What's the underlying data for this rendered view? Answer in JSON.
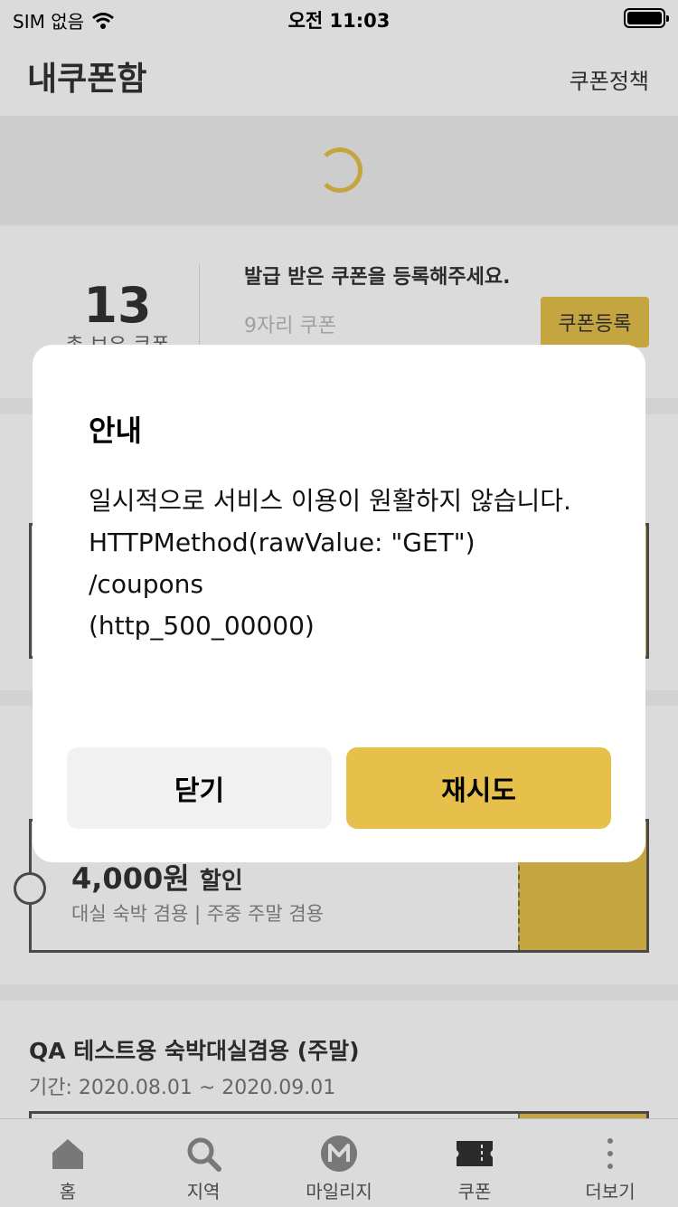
{
  "status_bar": {
    "carrier": "SIM 없음",
    "time": "오전 11:03"
  },
  "header": {
    "title": "내쿠폰함",
    "policy_link": "쿠폰정책"
  },
  "summary": {
    "count": "13",
    "count_label": "총 보유 쿠폰",
    "register_prompt": "발급 받은 쿠폰을 등록해주세요.",
    "input_placeholder": "9자리 쿠폰",
    "register_button": "쿠폰등록"
  },
  "coupons": [
    {
      "amount": "4,000원",
      "amount_suffix": "할인",
      "conditions": "대실 숙박 겸용 | 주중 주말 겸용"
    },
    {
      "title": "QA 테스트용 숙박대실겸용 (주말)",
      "period": "기간: 2020.08.01 ~ 2020.09.01"
    }
  ],
  "bottom_nav": [
    {
      "label": "홈",
      "icon": "home-icon"
    },
    {
      "label": "지역",
      "icon": "search-icon"
    },
    {
      "label": "마일리지",
      "icon": "mileage-icon"
    },
    {
      "label": "쿠폰",
      "icon": "ticket-icon"
    },
    {
      "label": "더보기",
      "icon": "more-icon"
    }
  ],
  "dialog": {
    "title": "안내",
    "lines": [
      "일시적으로 서비스 이용이 원활하지 않습니다.",
      "HTTPMethod(rawValue: \"GET\")",
      "/coupons",
      "(http_500_00000)"
    ],
    "close_label": "닫기",
    "retry_label": "재시도"
  },
  "colors": {
    "accent": "#e6c04b"
  }
}
